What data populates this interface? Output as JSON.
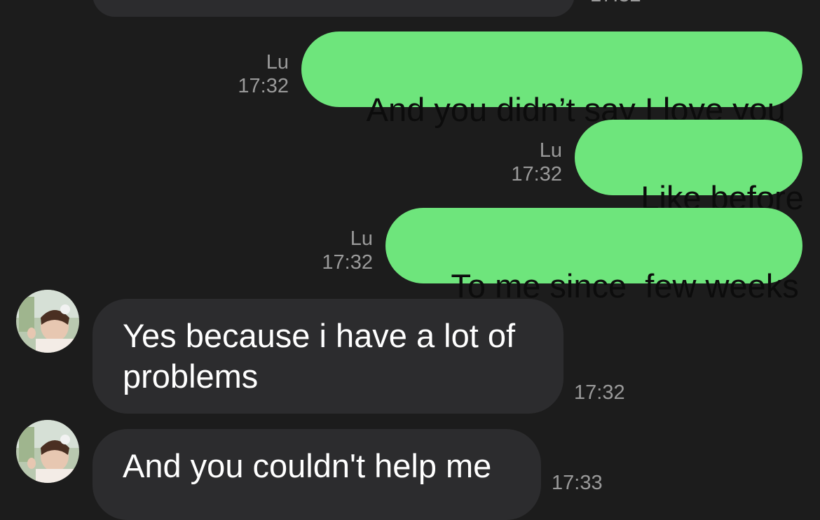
{
  "conversation": {
    "top_time_partial": "17:32",
    "messages": [
      {
        "direction": "out",
        "sender": "Lu",
        "time": "17:32",
        "text": "And you didn’t say I love you"
      },
      {
        "direction": "out",
        "sender": "Lu",
        "time": "17:32",
        "text": "Like before"
      },
      {
        "direction": "out",
        "sender": "Lu",
        "time": "17:32",
        "text": "To me since  few weeks"
      },
      {
        "direction": "in",
        "time": "17:32",
        "text": "Yes because i have a lot of problems"
      },
      {
        "direction": "in",
        "time": "17:33",
        "text": "And you couldn't help me"
      }
    ]
  },
  "colors": {
    "outgoing_bubble": "#6ee57c",
    "incoming_bubble": "#2c2c2e",
    "background": "#1c1c1c",
    "meta_text": "#9a9a9a"
  }
}
